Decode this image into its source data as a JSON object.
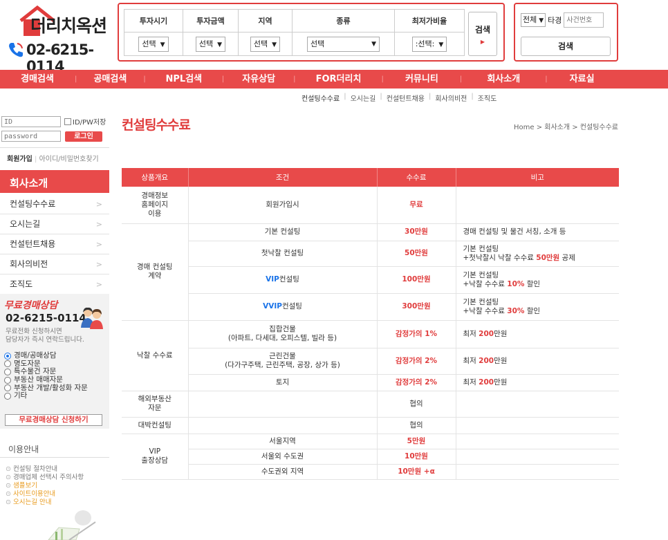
{
  "logo": {
    "name": "더리치옥션",
    "phone": "02-6215-0114"
  },
  "filters": {
    "headers": [
      "투자시기",
      "투자금액",
      "지역",
      "종류",
      "최저가비율"
    ],
    "values": [
      "선택",
      "선택",
      "선택",
      "선택",
      ":선택:"
    ],
    "search_label": "검색"
  },
  "case_search": {
    "scope": "전체",
    "label": "타경",
    "placeholder": "사건번호",
    "button": "검색"
  },
  "nav": [
    "경매검색",
    "공매검색",
    "NPL검색",
    "자유상담",
    "FOR더리치",
    "커뮤니티",
    "회사소개",
    "자료실"
  ],
  "subnav": [
    "컨설팅수수료",
    "오시는길",
    "컨설턴트채용",
    "회사의비전",
    "조직도"
  ],
  "login": {
    "id_placeholder": "ID",
    "pw_placeholder": "password",
    "save_label": "ID/PW저장",
    "login_button": "로그인",
    "join": "회원가입",
    "find": "아이디/비밀번호찾기"
  },
  "side": {
    "title": "회사소개",
    "items": [
      "컨설팅수수료",
      "오시는길",
      "컨설턴트채용",
      "회사의비전",
      "조직도"
    ]
  },
  "consult": {
    "title": "무료경매상담",
    "phone": "02-6215-0114",
    "desc1": "무료전화 신청하시면",
    "desc2": "담당자가 즉시 연락드립니다.",
    "options": [
      "경매/공매상담",
      "명도자문",
      "특수물건 자문",
      "부동산 매매자문",
      "부동산 개발/활성화 자문",
      "기타"
    ],
    "button": "무료경매상담 신청하기"
  },
  "guide": {
    "title": "이용안내",
    "items": [
      "컨설팅 절차안내",
      "경매업체 선택시 주의사항",
      "샘플보기",
      "사이트이용안내",
      "오시는길 안내"
    ]
  },
  "page": {
    "title": "컨설팅수수료",
    "breadcrumb": "Home  >  회사소개  >  컨설팅수수료"
  },
  "fee_table": {
    "headers": [
      "상품개요",
      "조건",
      "수수료",
      "비고"
    ],
    "cat_homepage": "경매정보\n홈페이지\n이용",
    "cat_contract": "경매 컨설팅\n계약",
    "cat_success": "낙찰 수수료",
    "cat_overseas": "해외부동산\n자문",
    "cat_bigdeal": "대박컨설팅",
    "cat_vip": "VIP\n출장상담",
    "r_homepage": {
      "cond": "회원가입시",
      "fee": "무료",
      "note": ""
    },
    "r_basic": {
      "cond": "기본 컨설팅",
      "fee": "30만원",
      "note": "경매 컨설팅 및 물건 서칭, 소개 등"
    },
    "r_first": {
      "cond": "첫낙찰 컨설팅",
      "fee": "50만원",
      "note1": "기본 컨설팅",
      "note2a": "+첫낙찰시 낙찰 수수료 ",
      "note2b": "50만원",
      "note2c": " 공제"
    },
    "r_vip": {
      "cond_a": "VIP",
      "cond_b": "컨설팅",
      "fee": "100만원",
      "note1": "기본 컨설팅",
      "note2a": "+낙찰 수수료 ",
      "note2b": "10%",
      "note2c": " 할인"
    },
    "r_vvip": {
      "cond_a": "VVIP",
      "cond_b": "컨설팅",
      "fee": "300만원",
      "note1": "기본 컨설팅",
      "note2a": "+낙찰 수수료 ",
      "note2b": "30%",
      "note2c": " 할인"
    },
    "r_apt": {
      "cond1": "집합건물",
      "cond2": "(아파트, 다세대, 오피스텔, 빌라 등)",
      "fee": "감정가의 1%",
      "note_a": "최저 ",
      "note_b": "200",
      "note_c": "만원"
    },
    "r_house": {
      "cond1": "근린건물",
      "cond2": "(다가구주택, 근린주택, 공장, 상가 등)",
      "fee": "감정가의 2%",
      "note_a": "최저 ",
      "note_b": "200",
      "note_c": "만원"
    },
    "r_land": {
      "cond": "토지",
      "fee": "감정가의 2%",
      "note_a": "최저 ",
      "note_b": "200",
      "note_c": "만원"
    },
    "r_overseas": {
      "cond": "",
      "fee": "협의",
      "note": ""
    },
    "r_bigdeal": {
      "cond": "",
      "fee": "협의",
      "note": ""
    },
    "r_seoul": {
      "cond": "서울지역",
      "fee": "5만원",
      "note": ""
    },
    "r_metro": {
      "cond": "서울외 수도권",
      "fee": "10만원",
      "note": ""
    },
    "r_outside": {
      "cond": "수도권외 지역",
      "fee": "10만원 +α",
      "note": ""
    }
  },
  "colors": {
    "accent": "#e84a4a",
    "blue": "#1a73e8",
    "orange": "#e89a1c"
  }
}
